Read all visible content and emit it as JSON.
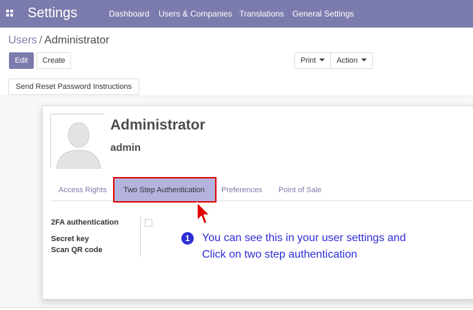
{
  "navbar": {
    "app_name": "Settings",
    "menus": [
      "Dashboard",
      "Users & Companies",
      "Translations",
      "General Settings"
    ],
    "apps_icon": "apps-grid-icon"
  },
  "breadcrumb": {
    "parent": "Users",
    "separator": "/",
    "current": "Administrator"
  },
  "buttons": {
    "edit": "Edit",
    "create": "Create",
    "print": "Print",
    "action": "Action",
    "reset_password": "Send Reset Password Instructions"
  },
  "user": {
    "name": "Administrator",
    "login": "admin",
    "avatar_icon": "user-avatar-placeholder"
  },
  "tabs": {
    "items": [
      "Access Rights",
      "Two Step Authentication",
      "Preferences",
      "Point of Sale"
    ],
    "active": "Two Step Authentication"
  },
  "fields": {
    "twofa_label": "2FA authentication",
    "twofa_checked": false,
    "secret_key_label": "Secret key",
    "qr_label": "Scan QR code"
  },
  "annotation": {
    "step": "1",
    "line1": "You can see this in your user settings and",
    "line2": "Click on two step authentication"
  },
  "colors": {
    "brand": "#7c7bad",
    "highlight_fill": "#b4b3de",
    "highlight_border": "#e00000",
    "annotation": "#2d2dd6"
  }
}
